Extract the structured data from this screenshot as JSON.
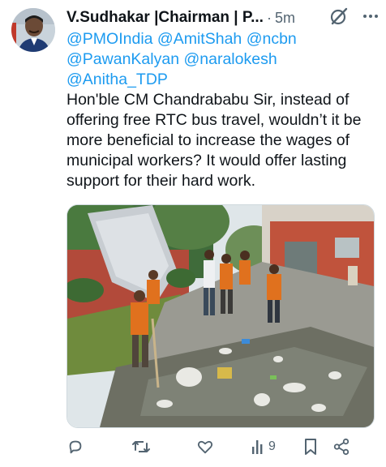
{
  "tweet": {
    "author_display": "V.Sudhakar |Chairman | P...",
    "time_separator": "·",
    "timestamp": "5m",
    "mentions": [
      "@PMOIndia",
      "@AmitShah",
      "@ncbn",
      "@PawanKalyan",
      "@naralokesh",
      "@Anitha_TDP"
    ],
    "body": "Hon'ble CM Chandrababu Sir, instead of offering free RTC bus travel, wouldn’t it be more beneficial to increase the wages of municipal workers? It would offer lasting support for their hard work."
  },
  "actions": {
    "views_count": "9"
  },
  "icons": {
    "avatar": "profile-photo",
    "grok": "grok-icon",
    "more": "more-icon",
    "reply": "reply-icon",
    "retweet": "retweet-icon",
    "like": "heart-icon",
    "views": "views-icon",
    "bookmark": "bookmark-icon",
    "share": "share-icon"
  },
  "colors": {
    "link": "#1d9bf0",
    "secondary_text": "#536471",
    "primary_text": "#0f1419"
  }
}
